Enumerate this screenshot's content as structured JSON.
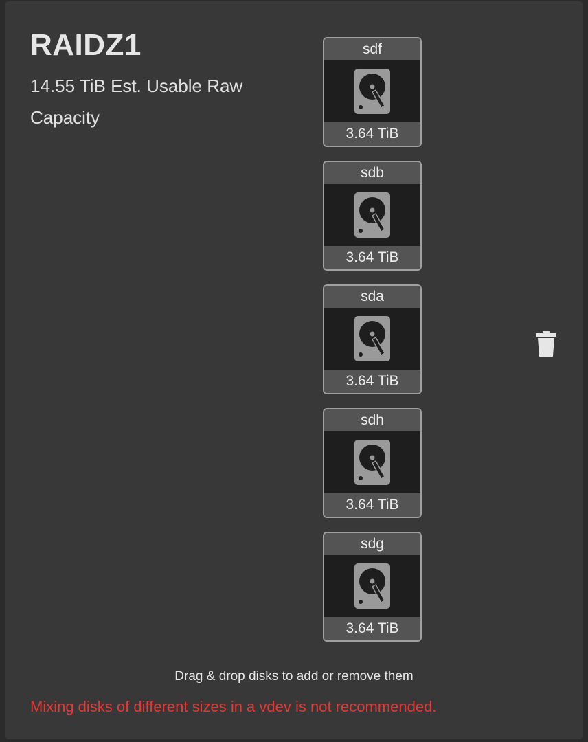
{
  "vdev": {
    "title": "RAIDZ1",
    "capacity_text": "14.55 TiB Est. Usable Raw Capacity"
  },
  "disks": [
    {
      "name": "sdf",
      "size": "3.64 TiB"
    },
    {
      "name": "sdb",
      "size": "3.64 TiB"
    },
    {
      "name": "sda",
      "size": "3.64 TiB"
    },
    {
      "name": "sdh",
      "size": "3.64 TiB"
    },
    {
      "name": "sdg",
      "size": "3.64 TiB"
    }
  ],
  "icons": {
    "disk": "hard-disk-icon",
    "remove": "trash-icon"
  },
  "hint": "Drag & drop disks to add or remove them",
  "warning": "Mixing disks of different sizes in a vdev is not recommended.",
  "colors": {
    "warning": "#e53935",
    "panel": "#383838",
    "disk_header": "#545454"
  }
}
